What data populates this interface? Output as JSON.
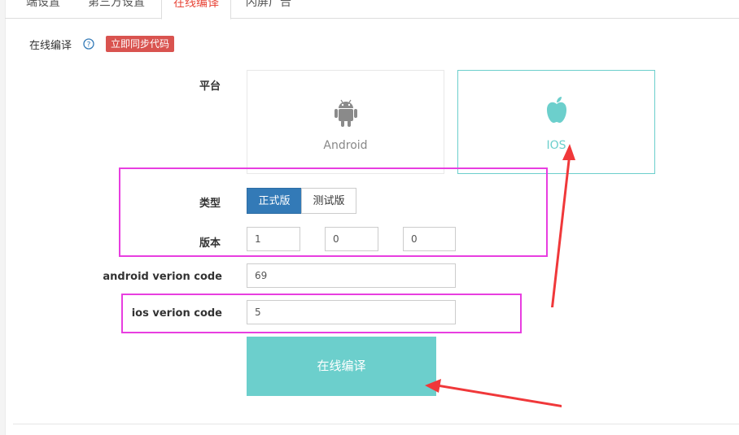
{
  "tabs": [
    {
      "label": "端设置"
    },
    {
      "label": "第三方设置"
    },
    {
      "label": "在线编译"
    },
    {
      "label": "闪屏广告"
    }
  ],
  "section": {
    "title": "在线编译",
    "sync_label": "立即同步代码"
  },
  "form": {
    "platform_label": "平台",
    "platforms": [
      {
        "label": "Android",
        "icon": "android-icon",
        "selected": false
      },
      {
        "label": "IOS",
        "icon": "apple-icon",
        "selected": true
      }
    ],
    "type_label": "类型",
    "types": [
      {
        "label": "正式版",
        "active": true
      },
      {
        "label": "测试版",
        "active": false
      }
    ],
    "version_label": "版本",
    "version": [
      "1",
      "0",
      "0"
    ],
    "android_code_label": "android verion code",
    "android_code": "69",
    "ios_code_label": "ios verion code",
    "ios_code": "5",
    "compile_label": "在线编译"
  },
  "colors": {
    "accent": "#6ccfcc",
    "primary": "#337ab7",
    "badge": "#d9534f",
    "active_tab": "#e8473a",
    "annotation_box": "#e83ee0",
    "annotation_arrow": "#f0383a"
  }
}
